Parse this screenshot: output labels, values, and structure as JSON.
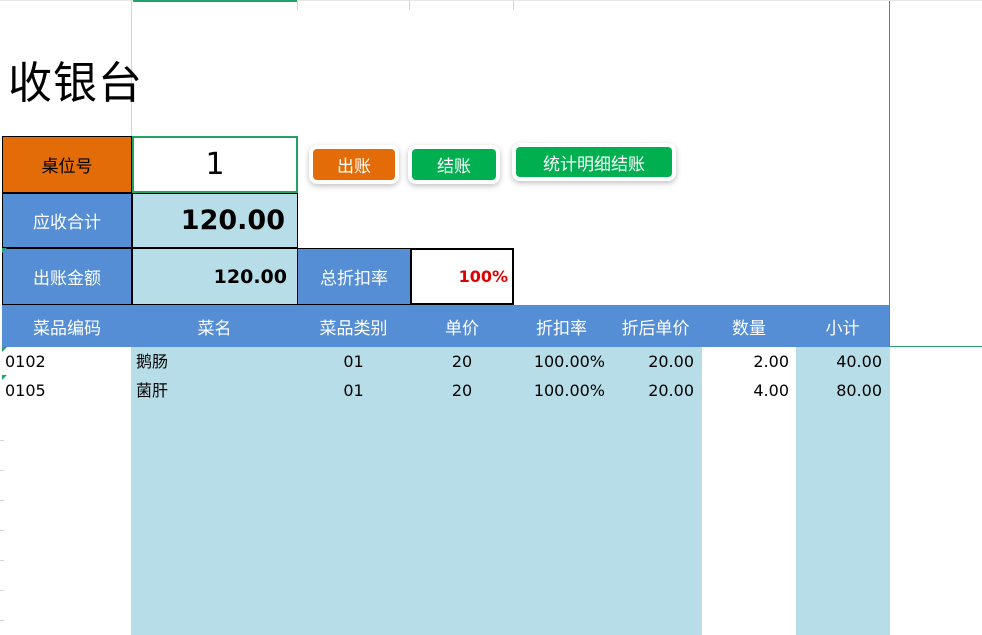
{
  "title": "收银台",
  "table_no": {
    "label": "桌位号",
    "value": "1"
  },
  "receivable": {
    "label": "应收合计",
    "value": "120.00"
  },
  "checkout_amount": {
    "label": "出账金额",
    "value": "120.00"
  },
  "discount": {
    "label": "总折扣率",
    "value": "100%"
  },
  "buttons": {
    "checkout": "出账",
    "settle": "结账",
    "stats": "统计明细结账"
  },
  "columns": [
    "菜品编码",
    "菜名",
    "菜品类别",
    "单价",
    "折扣率",
    "折后单价",
    "数量",
    "小计"
  ],
  "rows": [
    {
      "code": "0102",
      "name": "鹅肠",
      "category": "01",
      "price": "20",
      "discount": "100.00%",
      "discounted_price": "20.00",
      "qty": "2.00",
      "subtotal": "40.00"
    },
    {
      "code": "0105",
      "name": "菌肝",
      "category": "01",
      "price": "20",
      "discount": "100.00%",
      "discounted_price": "20.00",
      "qty": "4.00",
      "subtotal": "80.00"
    }
  ],
  "colors": {
    "orange": "#e36c09",
    "blue": "#558ed5",
    "light_blue": "#b7dee8",
    "green": "#00b050",
    "red": "#e00000"
  }
}
